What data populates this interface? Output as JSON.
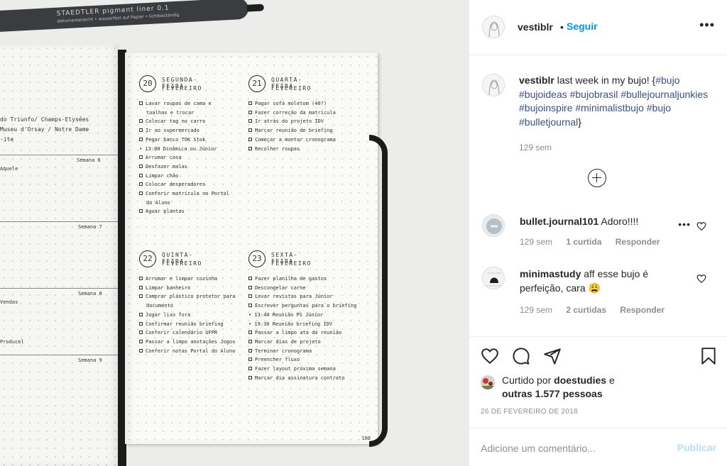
{
  "post": {
    "username": "vestiblr",
    "follow_sep": "•",
    "follow_label": "Seguir",
    "more_label": "•••",
    "caption_text": "last week in my bujo! {",
    "caption_tags": "#bujo #bujoideas #bujobrasil #bullejournaljunkies #bujoinspire #minimalistbujo #bujo #bulletjournal",
    "caption_end": "}",
    "caption_time": "129 sem"
  },
  "comments": [
    {
      "username": "bullet.journal101",
      "text": "Adoro!!!!",
      "time": "129 sem",
      "likes": "1 curtida",
      "reply": "Responder",
      "more": "•••"
    },
    {
      "username": "minimastudy",
      "text": "aff esse bujo é perfeição, cara 😩",
      "time": "129 sem",
      "likes": "2 curtidas",
      "reply": "Responder"
    }
  ],
  "actions": {
    "liked_prefix": "Curtido por",
    "liked_user": "doestudies",
    "liked_and": "e",
    "liked_others": "outras 1.577 pessoas",
    "date": "26 DE FEVEREIRO DE 2018"
  },
  "comment_box": {
    "placeholder": "Adicione um comentário...",
    "post_label": "Publicar"
  },
  "photo": {
    "pen_brand": "STAEDTLER pigment liner 0.1",
    "pen_sub": "dokumentenecht • wasserfest auf Papier • lichtbeständig",
    "left_page": {
      "lines": [
        "do Triunfo/ Champs-Elysées",
        "Museu d'Orsay / Notre Dame",
        "-ite"
      ],
      "words": [
        "Aquele",
        "Vendas",
        "Producel"
      ],
      "weeks": [
        "Semana 6",
        "Semana 7",
        "Semana 8",
        "Semana 9"
      ]
    },
    "days": [
      {
        "num": "20",
        "name": "SEGUNDA-FEIRA",
        "month": "FEVEREIRO",
        "tasks": [
          "Lavar roupas de cama e",
          "toalhas e trocar",
          "Colocar tag no carro",
          "Ir ao supermercado",
          "Pegar banco TOK Stok",
          "• 13:00 Dinâmica ou Júnior",
          "Arrumar casa",
          "Desfazer malas",
          "Limpar chão",
          "Colocar desperadores",
          "Conferir matrícula no Portal",
          "do Aluno",
          "Aguar plantas"
        ]
      },
      {
        "num": "21",
        "name": "QUARTA-FEIRA",
        "month": "FEVEREIRO",
        "tasks": [
          "Pagar sofá moletom (40?)",
          "Fazer correção da matrícula",
          "Ir atrás do projeto IDV",
          "Marcar reunião de briefing",
          "Começar a montar cronograma",
          "Recolher roupas"
        ]
      },
      {
        "num": "22",
        "name": "QUINTA-FEIRA",
        "month": "FEVEREIRO",
        "tasks": [
          "Arrumar e limpar cozinha",
          "Limpar banheiro",
          "Comprar plástico protetor para",
          "documento",
          "Jogar lixo fora",
          "Confirmar reunião briefing",
          "Conferir calendário UFPR",
          "Passar a limpo anotações Jogos",
          "Conferir notas Portal do Aluno"
        ]
      },
      {
        "num": "23",
        "name": "SEXTA-FEIRA",
        "month": "FEVEREIRO",
        "tasks": [
          "Fazer planilha de gastos",
          "Descongelar carne",
          "Levar revistas para Júnior",
          "Escrever perguntas para o briefing",
          "• 13:40 Reunião PS Júnior",
          "• 19:30 Reunião briefing IDV",
          "Passar a limpo ata da reunião",
          "Marcar dias de projeto",
          "Terminar cronograma",
          "Preencher fluxo",
          "Fazer layout próxima semana",
          "Marcar dia assinatura contrato"
        ]
      }
    ],
    "page_number": "100"
  },
  "colors": {
    "link_blue": "#0095f6",
    "hashtag": "#385185",
    "muted": "#8e8e8e",
    "post_disabled": "#b2dffc"
  }
}
